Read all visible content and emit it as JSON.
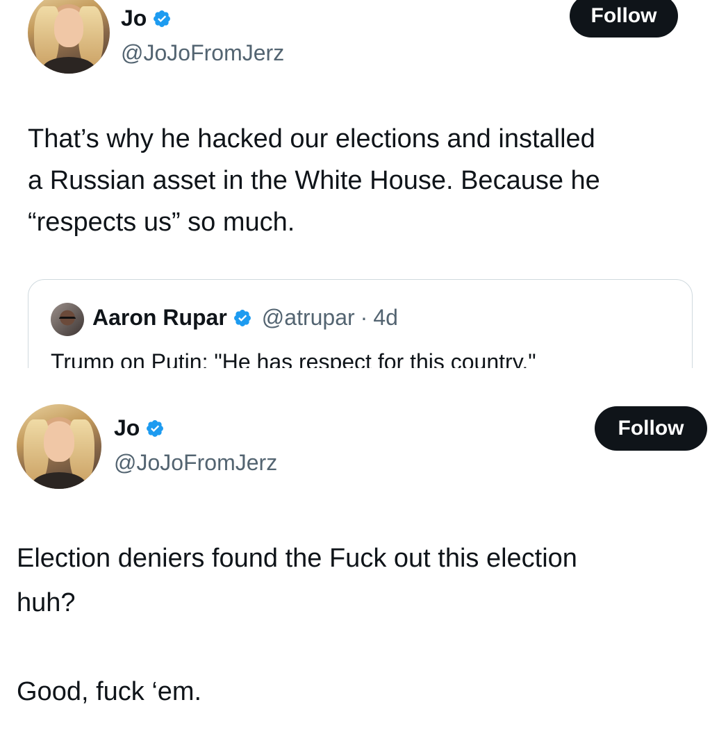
{
  "tweet1": {
    "author": {
      "display_name": "Jo",
      "handle": "@JoJoFromJerz",
      "avatar_icon": "profile-photo",
      "verified_icon": "verified-badge-icon"
    },
    "follow_label": "Follow",
    "text": "That’s why he hacked our elections and installed\na Russian asset in the White House. Because he\n“respects us” so much.",
    "quote": {
      "display_name": "Aaron Rupar",
      "handle": "@atrupar",
      "separator": "·",
      "time": "4d",
      "text": "Trump on Putin: \"He has respect for this country.\""
    }
  },
  "tweet2": {
    "author": {
      "display_name": "Jo",
      "handle": "@JoJoFromJerz",
      "avatar_icon": "profile-photo",
      "verified_icon": "verified-badge-icon"
    },
    "follow_label": "Follow",
    "text": "Election deniers found the Fuck out this election\nhuh?\n\nGood, fuck ‘em."
  },
  "colors": {
    "text_primary": "#0f1419",
    "text_secondary": "#536471",
    "verified_blue": "#1d9bf0",
    "border": "#cfd9de",
    "button_bg": "#0f1419"
  }
}
